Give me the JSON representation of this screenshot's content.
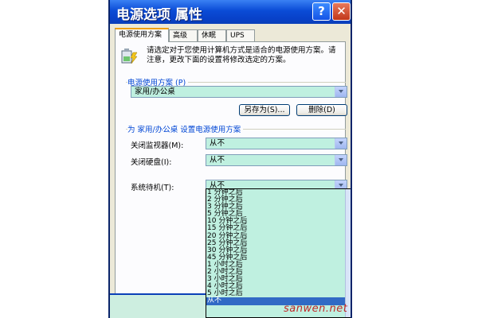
{
  "window": {
    "title": "电源选项 属性",
    "help_glyph": "?",
    "close_glyph": "✕"
  },
  "tabs": [
    {
      "label": "电源使用方案",
      "active": true
    },
    {
      "label": "高级",
      "active": false
    },
    {
      "label": "休眠",
      "active": false
    },
    {
      "label": "UPS",
      "active": false
    }
  ],
  "intro_text": "请选定对于您使用计算机方式是适合的电源使用方案。请注意，更改下面的设置将修改选定的方案。",
  "scheme_group": {
    "label": "电源使用方案 (P)",
    "selected": "家用/办公桌",
    "save_as_label": "另存为(S)...",
    "delete_label": "删除(D)"
  },
  "settings_group": {
    "label": "为 家用/办公桌 设置电源使用方案",
    "monitor_label": "关闭监视器(M):",
    "monitor_value": "从不",
    "disk_label": "关闭硬盘(I):",
    "disk_value": "从不",
    "standby_label": "系统待机(T):",
    "standby_value": "从不"
  },
  "standby_options": [
    "1 分钟之后",
    "2 分钟之后",
    "3 分钟之后",
    "5 分钟之后",
    "10 分钟之后",
    "15 分钟之后",
    "20 分钟之后",
    "25 分钟之后",
    "30 分钟之后",
    "45 分钟之后",
    "1 小时之后",
    "2 小时之后",
    "3 小时之后",
    "4 小时之后",
    "5 小时之后",
    "从不"
  ],
  "watermark": "sanwen.net",
  "colors": {
    "title_bar": "#0a4bd6",
    "combo_fill": "#bff0e0",
    "selection": "#316ac5",
    "close_button": "#c1371a"
  }
}
